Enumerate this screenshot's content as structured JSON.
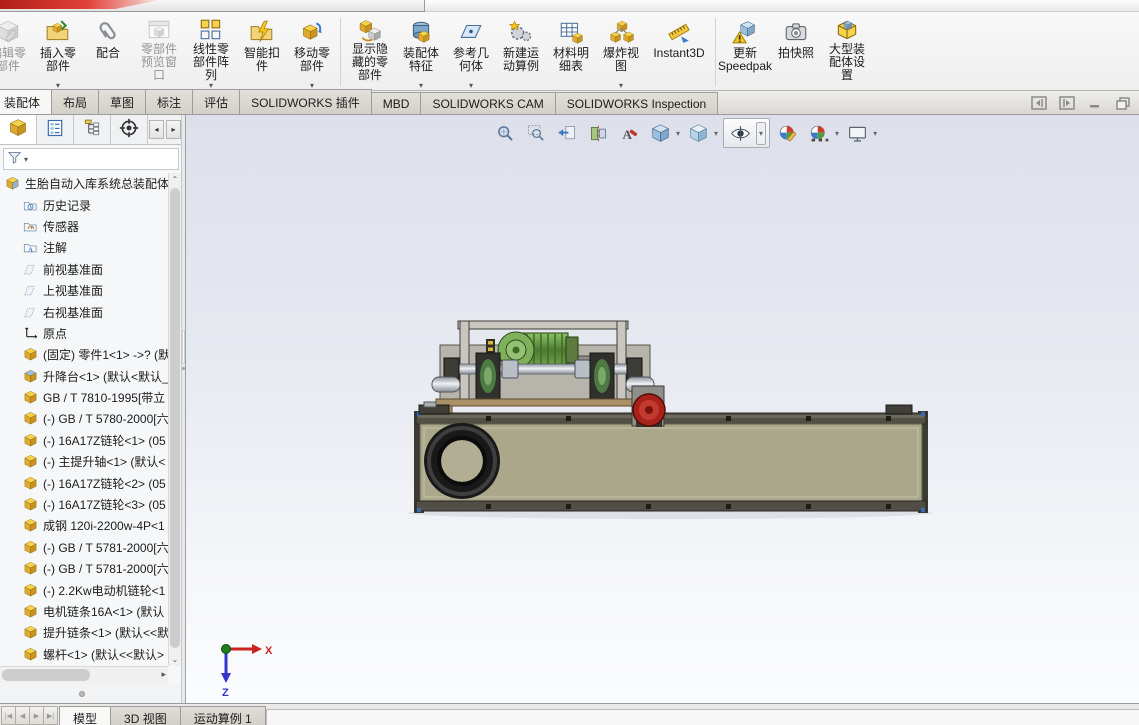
{
  "app": {
    "name": "SOLIDWORKS"
  },
  "ribbon": {
    "buttons": [
      {
        "id": "edit-component",
        "label": "编辑零部件",
        "disabled": true,
        "dropdown": false
      },
      {
        "id": "insert-component",
        "label": "插入零部件",
        "disabled": false,
        "dropdown": true
      },
      {
        "id": "mate",
        "label": "配合",
        "disabled": false,
        "dropdown": false
      },
      {
        "id": "component-preview-window",
        "label": "零部件预览窗口",
        "disabled": true,
        "dropdown": false
      },
      {
        "id": "linear-component-pattern",
        "label": "线性零部件阵列",
        "disabled": false,
        "dropdown": true
      },
      {
        "id": "smart-fasteners",
        "label": "智能扣件",
        "disabled": false,
        "dropdown": false
      },
      {
        "id": "move-component",
        "label": "移动零部件",
        "disabled": false,
        "dropdown": true,
        "sep_after": true
      },
      {
        "id": "show-hidden-components",
        "label": "显示隐藏的零部件",
        "disabled": false,
        "dropdown": false
      },
      {
        "id": "assembly-features",
        "label": "装配体特征",
        "disabled": false,
        "dropdown": true
      },
      {
        "id": "reference-geometry",
        "label": "参考几何体",
        "disabled": false,
        "dropdown": true
      },
      {
        "id": "new-motion-study",
        "label": "新建运动算例",
        "disabled": false,
        "dropdown": false
      },
      {
        "id": "bill-of-materials",
        "label": "材料明细表",
        "disabled": false,
        "dropdown": false
      },
      {
        "id": "exploded-view",
        "label": "爆炸视图",
        "disabled": false,
        "dropdown": true
      },
      {
        "id": "instant3d",
        "label": "Instant3D",
        "disabled": false,
        "dropdown": false,
        "sep_after": true
      },
      {
        "id": "update-speedpak",
        "label": "更新 Speedpak",
        "disabled": false,
        "dropdown": false
      },
      {
        "id": "take-snapshot",
        "label": "拍快照",
        "disabled": false,
        "dropdown": false
      },
      {
        "id": "large-assembly-settings",
        "label": "大型装配体设置",
        "disabled": false,
        "dropdown": false
      }
    ]
  },
  "command_tabs": {
    "active_index": 0,
    "tabs": [
      "装配体",
      "布局",
      "草图",
      "标注",
      "评估",
      "SOLIDWORKS 插件",
      "MBD",
      "SOLIDWORKS CAM",
      "SOLIDWORKS Inspection"
    ]
  },
  "window_controls": [
    "collapse-left",
    "collapse-right",
    "minimize",
    "restore"
  ],
  "feature_panel": {
    "tabs": [
      {
        "id": "featuremanager",
        "active": true
      },
      {
        "id": "propertymanager",
        "active": false
      },
      {
        "id": "configurationmanager",
        "active": false
      },
      {
        "id": "dimxpertmanager",
        "active": false
      }
    ],
    "tree": [
      {
        "type": "assembly-root",
        "label": "生胎自动入库系统总装配体",
        "root": true
      },
      {
        "type": "history-folder",
        "label": "历史记录"
      },
      {
        "type": "sensors-folder",
        "label": "传感器"
      },
      {
        "type": "annotations-folder",
        "label": "注解"
      },
      {
        "type": "plane",
        "label": "前视基准面"
      },
      {
        "type": "plane",
        "label": "上视基准面"
      },
      {
        "type": "plane",
        "label": "右视基准面"
      },
      {
        "type": "origin",
        "label": "原点"
      },
      {
        "type": "part",
        "label": "(固定) 零件1<1> ->? (默"
      },
      {
        "type": "subassembly",
        "label": "升降台<1> (默认<默认_"
      },
      {
        "type": "part",
        "label": "GB / T 7810-1995[带立"
      },
      {
        "type": "part",
        "label": "(-) GB / T 5780-2000[六"
      },
      {
        "type": "part",
        "label": "(-) 16A17Z链轮<1> (05"
      },
      {
        "type": "part",
        "label": "(-) 主提升轴<1> (默认<"
      },
      {
        "type": "part",
        "label": "(-) 16A17Z链轮<2> (05"
      },
      {
        "type": "part",
        "label": "(-) 16A17Z链轮<3> (05"
      },
      {
        "type": "part",
        "label": "成钢 120i-2200w-4P<1"
      },
      {
        "type": "part",
        "label": "(-) GB / T 5781-2000[六"
      },
      {
        "type": "part",
        "label": "(-) GB / T 5781-2000[六"
      },
      {
        "type": "part",
        "label": "(-) 2.2Kw电动机链轮<1"
      },
      {
        "type": "part",
        "label": "电机链条16A<1> (默认"
      },
      {
        "type": "part",
        "label": "提升链条<1> (默认<<默"
      },
      {
        "type": "part",
        "label": "螺杆<1> (默认<<默认>"
      }
    ]
  },
  "viewport_toolbar": {
    "buttons": [
      {
        "id": "zoom-to-fit",
        "dropdown": false
      },
      {
        "id": "zoom-to-area",
        "dropdown": false
      },
      {
        "id": "previous-view",
        "dropdown": false
      },
      {
        "id": "section-view",
        "dropdown": false
      },
      {
        "id": "hide-annotations",
        "dropdown": false
      },
      {
        "id": "view-orientation",
        "dropdown": true
      },
      {
        "id": "display-style",
        "dropdown": true
      },
      {
        "id": "hide-show-items",
        "dropdown": true,
        "pressed": true
      },
      {
        "id": "edit-appearance",
        "dropdown": false
      },
      {
        "id": "apply-scene",
        "dropdown": true
      },
      {
        "id": "view-settings",
        "dropdown": true
      }
    ]
  },
  "viewport": {
    "model_description": "绿胎自动入库系统 — 提升机构与轮胎输送机总装 (侧视图)",
    "triad": {
      "x_label": "X",
      "z_label": "Z"
    }
  },
  "bottom_bar": {
    "nav": [
      "first",
      "previous",
      "next",
      "last"
    ],
    "tabs": [
      {
        "label": "模型",
        "active": true
      },
      {
        "label": "3D 视图",
        "active": false
      },
      {
        "label": "运动算例 1",
        "active": false
      }
    ]
  },
  "colors": {
    "conveyor_deck": "#aaa78a",
    "conveyor_rail": "#514f45",
    "tire": "#191919",
    "motor_green": "#6fa24e",
    "motor_red": "#a8221a",
    "frame_gray": "#c9c6bf",
    "panel_gray": "#b7b4ab",
    "shaft_silver": "#c7ccd3",
    "table_tan": "#ab9168",
    "viewport_gradient_top": "#dde0ea",
    "viewport_gradient_bottom": "#fbfcfd",
    "triad_x": "#cc2222",
    "triad_z": "#3535cc",
    "triad_origin": "#1e7d1e"
  }
}
